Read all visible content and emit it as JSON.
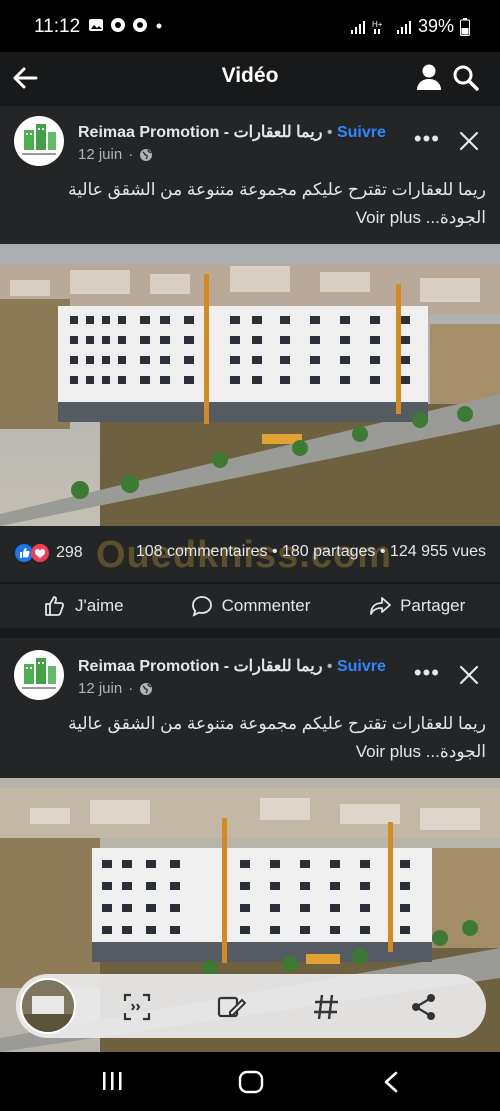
{
  "status": {
    "time": "11:12",
    "battery": "39%",
    "icons": [
      "gallery-icon",
      "chrome-icon",
      "chrome-icon",
      "dot-icon"
    ],
    "right_icons": [
      "signal-icon",
      "network-icon",
      "signal-icon",
      "battery-icon"
    ]
  },
  "header": {
    "title": "Vidéo",
    "icons": [
      "back-arrow-icon",
      "person-icon",
      "search-icon"
    ]
  },
  "posts": [
    {
      "author": "Reimaa Promotion - ريما للعقارات",
      "separator": "•",
      "follow": "Suivre",
      "date": "12 juin",
      "date_separator": "·",
      "caption": "ريما للعقارات تقترح عليكم مجموعة متنوعة من الشقق عالية الجودة...",
      "see_more": "Voir plus",
      "reactions": {
        "count": "298",
        "comments": "108 commentaires",
        "shares": "180 partages",
        "views": "124 955 vues",
        "dot": "•"
      },
      "watermark": "Ouedkniss.com",
      "actions": [
        "J'aime",
        "Commenter",
        "Partager"
      ]
    },
    {
      "author": "Reimaa Promotion - ريما للعقارات",
      "separator": "•",
      "follow": "Suivre",
      "date": "12 juin",
      "date_separator": "·",
      "caption": "ريما للعقارات تقترح عليكم مجموعة متنوعة من الشقق عالية الجودة...",
      "see_more": "Voir plus"
    }
  ],
  "colors": {
    "background": "#18191a",
    "card": "#242526",
    "link_blue": "#2d88ff",
    "text": "#e4e6eb",
    "secondary_text": "#b0b3b8"
  },
  "toolbar_icons": [
    "scan-text-icon",
    "edit-image-icon",
    "hashtag-icon",
    "share-icon"
  ],
  "nav_icons": [
    "recents-icon",
    "home-icon",
    "back-icon"
  ]
}
